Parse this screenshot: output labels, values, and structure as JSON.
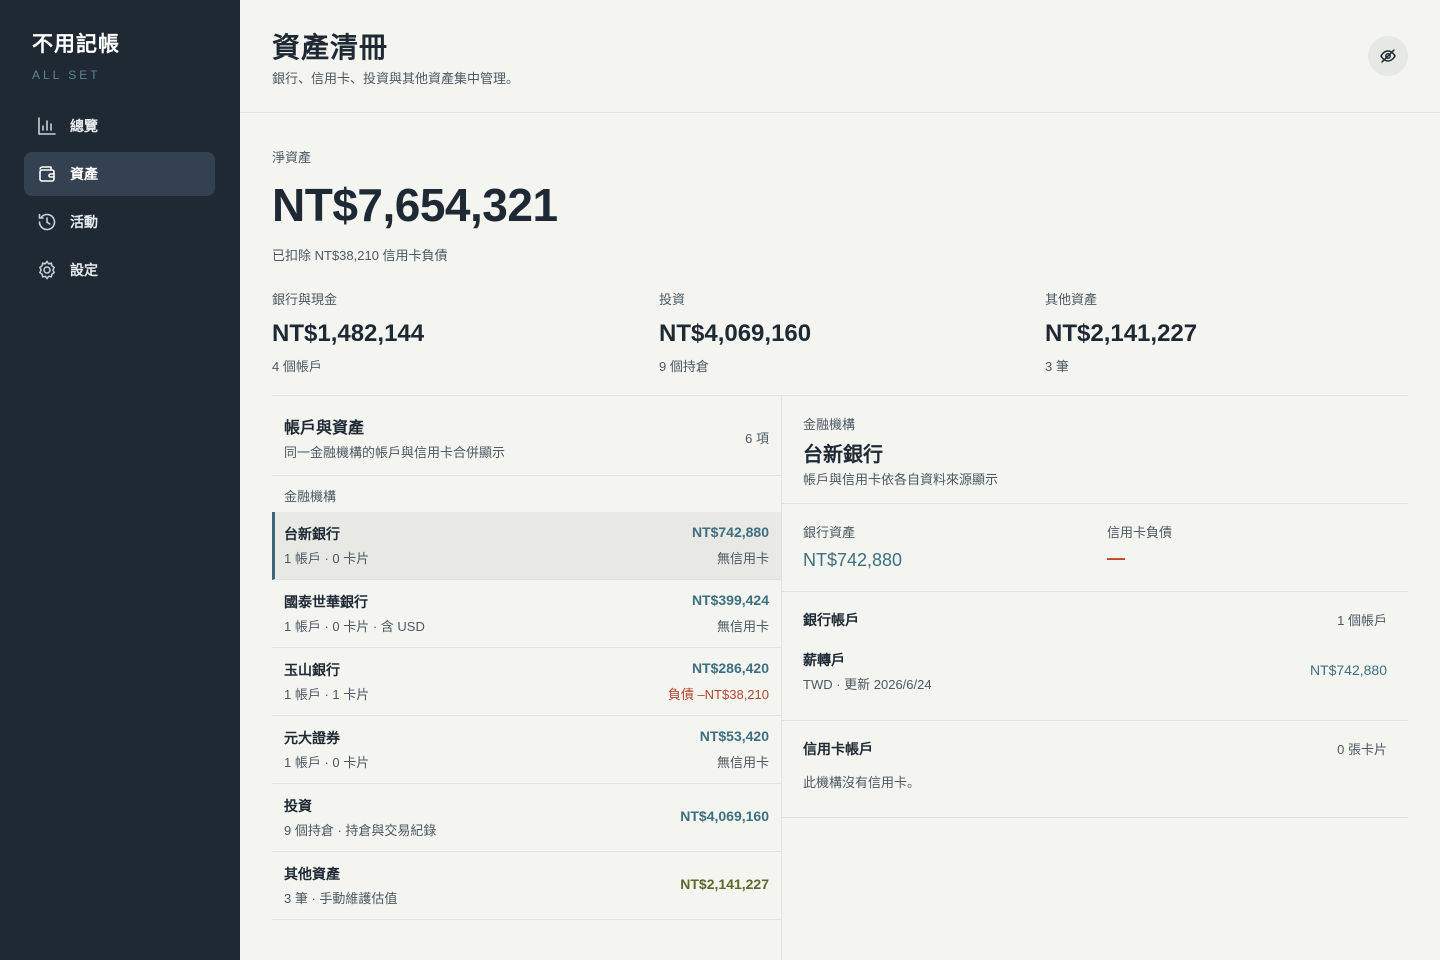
{
  "brand": {
    "title": "不用記帳",
    "subtitle": "ALL SET"
  },
  "nav": [
    {
      "label": "總覽",
      "icon": "chart-icon"
    },
    {
      "label": "資產",
      "icon": "wallet-icon",
      "active": true
    },
    {
      "label": "活動",
      "icon": "history-icon"
    },
    {
      "label": "設定",
      "icon": "gear-icon"
    }
  ],
  "header": {
    "title": "資產清冊",
    "subtitle": "銀行、信用卡、投資與其他資產集中管理。",
    "hide_button_icon": "eye-off-icon"
  },
  "net_worth": {
    "label": "淨資產",
    "value": "NT$7,654,321",
    "note": "已扣除 NT$38,210 信用卡負債"
  },
  "stats": [
    {
      "label": "銀行與現金",
      "value": "NT$1,482,144",
      "meta": "4 個帳戶"
    },
    {
      "label": "投資",
      "value": "NT$4,069,160",
      "meta": "9 個持倉"
    },
    {
      "label": "其他資產",
      "value": "NT$2,141,227",
      "meta": "3 筆"
    }
  ],
  "left_panel": {
    "title": "帳戶與資產",
    "subtitle": "同一金融機構的帳戶與信用卡合併顯示",
    "count": "6 項",
    "section_label": "金融機構",
    "rows": [
      {
        "name": "台新銀行",
        "meta": "1 帳戶 · 0 卡片",
        "amount": "NT$742,880",
        "status": "無信用卡"
      },
      {
        "name": "國泰世華銀行",
        "meta": "1 帳戶 · 0 卡片 · 含 USD",
        "amount": "NT$399,424",
        "status": "無信用卡"
      },
      {
        "name": "玉山銀行",
        "meta": "1 帳戶 · 1 卡片",
        "amount": "NT$286,420",
        "status": "負債 –NT$38,210"
      },
      {
        "name": "元大證券",
        "meta": "1 帳戶 · 0 卡片",
        "amount": "NT$53,420",
        "status": "無信用卡"
      },
      {
        "name": "投資",
        "meta": "9 個持倉 · 持倉與交易紀錄",
        "amount": "NT$4,069,160"
      },
      {
        "name": "其他資產",
        "meta": "3 筆 · 手動維護估值",
        "amount": "NT$2,141,227"
      }
    ]
  },
  "detail": {
    "kicker": "金融機構",
    "title": "台新銀行",
    "subtitle": "帳戶與信用卡依各自資料來源顯示",
    "bank_assets_label": "銀行資產",
    "bank_assets_value": "NT$742,880",
    "card_debt_label": "信用卡負債",
    "card_debt_value": "—",
    "bank_section_title": "銀行帳戶",
    "bank_section_count": "1 個帳戶",
    "account_name": "薪轉戶",
    "account_meta": "TWD · 更新 2026/6/24",
    "account_amount": "NT$742,880",
    "card_section_title": "信用卡帳戶",
    "card_section_count": "0 張卡片",
    "card_empty": "此機構沒有信用卡。"
  },
  "colors": {
    "sidebar": "#1f2933",
    "accent": "#3d6f80",
    "debt": "#b5462c",
    "olive": "#5a6a2a",
    "background": "#f4f5f1"
  }
}
